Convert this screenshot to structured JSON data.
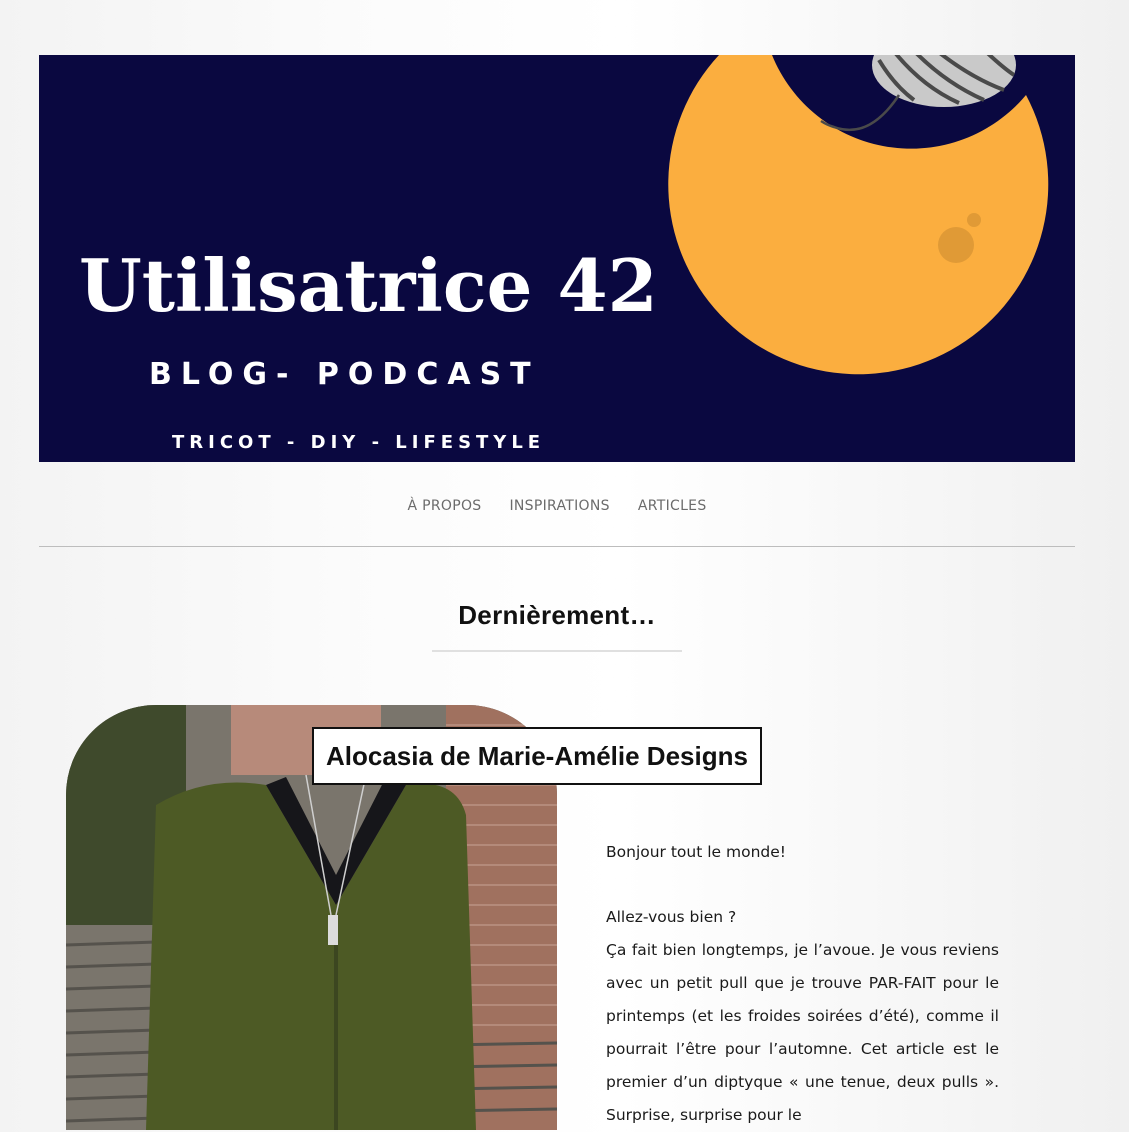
{
  "banner": {
    "title": "Utilisatrice 42",
    "subtitle": "BLOG- PODCAST",
    "tagline": "TRICOT - DIY - LIFESTYLE",
    "colors": {
      "background": "#0a0840",
      "moon": "#fbae3f",
      "yarn": "#c9c9c9"
    }
  },
  "nav": {
    "items": [
      {
        "label": "À PROPOS"
      },
      {
        "label": "INSPIRATIONS"
      },
      {
        "label": "ARTICLES"
      }
    ]
  },
  "section": {
    "title": "Dernièrement…"
  },
  "post": {
    "title": "Alocasia de Marie-Amélie Designs",
    "paragraphs": [
      "Bonjour tout le monde!",
      "Allez-vous bien ?",
      "Ça fait bien longtemps, je l’avoue. Je vous reviens avec un petit pull que je trouve PAR-FAIT pour le printemps (et les froides soirées d’été), comme il pourrait l’être pour l’automne. Cet article est le premier d’un diptyque « une tenue, deux pulls ». Surprise, surprise pour le"
    ]
  }
}
